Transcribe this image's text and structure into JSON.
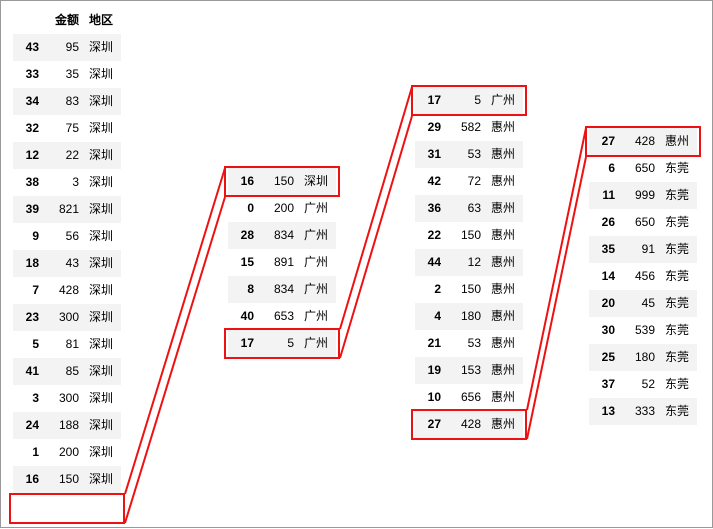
{
  "headers": {
    "id": "",
    "amt": "金额",
    "city": "地区"
  },
  "col1": [
    {
      "id": "43",
      "amt": "95",
      "city": "深圳"
    },
    {
      "id": "33",
      "amt": "35",
      "city": "深圳"
    },
    {
      "id": "34",
      "amt": "83",
      "city": "深圳"
    },
    {
      "id": "32",
      "amt": "75",
      "city": "深圳"
    },
    {
      "id": "12",
      "amt": "22",
      "city": "深圳"
    },
    {
      "id": "38",
      "amt": "3",
      "city": "深圳"
    },
    {
      "id": "39",
      "amt": "821",
      "city": "深圳"
    },
    {
      "id": "9",
      "amt": "56",
      "city": "深圳"
    },
    {
      "id": "18",
      "amt": "43",
      "city": "深圳"
    },
    {
      "id": "7",
      "amt": "428",
      "city": "深圳"
    },
    {
      "id": "23",
      "amt": "300",
      "city": "深圳"
    },
    {
      "id": "5",
      "amt": "81",
      "city": "深圳"
    },
    {
      "id": "41",
      "amt": "85",
      "city": "深圳"
    },
    {
      "id": "3",
      "amt": "300",
      "city": "深圳"
    },
    {
      "id": "24",
      "amt": "188",
      "city": "深圳"
    },
    {
      "id": "1",
      "amt": "200",
      "city": "深圳"
    },
    {
      "id": "16",
      "amt": "150",
      "city": "深圳"
    }
  ],
  "col2": [
    {
      "id": "16",
      "amt": "150",
      "city": "深圳"
    },
    {
      "id": "0",
      "amt": "200",
      "city": "广州"
    },
    {
      "id": "28",
      "amt": "834",
      "city": "广州"
    },
    {
      "id": "15",
      "amt": "891",
      "city": "广州"
    },
    {
      "id": "8",
      "amt": "834",
      "city": "广州"
    },
    {
      "id": "40",
      "amt": "653",
      "city": "广州"
    },
    {
      "id": "17",
      "amt": "5",
      "city": "广州"
    }
  ],
  "col3": [
    {
      "id": "17",
      "amt": "5",
      "city": "广州"
    },
    {
      "id": "29",
      "amt": "582",
      "city": "惠州"
    },
    {
      "id": "31",
      "amt": "53",
      "city": "惠州"
    },
    {
      "id": "42",
      "amt": "72",
      "city": "惠州"
    },
    {
      "id": "36",
      "amt": "63",
      "city": "惠州"
    },
    {
      "id": "22",
      "amt": "150",
      "city": "惠州"
    },
    {
      "id": "44",
      "amt": "12",
      "city": "惠州"
    },
    {
      "id": "2",
      "amt": "150",
      "city": "惠州"
    },
    {
      "id": "4",
      "amt": "180",
      "city": "惠州"
    },
    {
      "id": "21",
      "amt": "53",
      "city": "惠州"
    },
    {
      "id": "19",
      "amt": "153",
      "city": "惠州"
    },
    {
      "id": "10",
      "amt": "656",
      "city": "惠州"
    },
    {
      "id": "27",
      "amt": "428",
      "city": "惠州"
    }
  ],
  "col4": [
    {
      "id": "27",
      "amt": "428",
      "city": "惠州"
    },
    {
      "id": "6",
      "amt": "650",
      "city": "东莞"
    },
    {
      "id": "11",
      "amt": "999",
      "city": "东莞"
    },
    {
      "id": "26",
      "amt": "650",
      "city": "东莞"
    },
    {
      "id": "35",
      "amt": "91",
      "city": "东莞"
    },
    {
      "id": "14",
      "amt": "456",
      "city": "东莞"
    },
    {
      "id": "20",
      "amt": "45",
      "city": "东莞"
    },
    {
      "id": "30",
      "amt": "539",
      "city": "东莞"
    },
    {
      "id": "25",
      "amt": "180",
      "city": "东莞"
    },
    {
      "id": "37",
      "amt": "52",
      "city": "东莞"
    },
    {
      "id": "13",
      "amt": "333",
      "city": "东莞"
    }
  ]
}
